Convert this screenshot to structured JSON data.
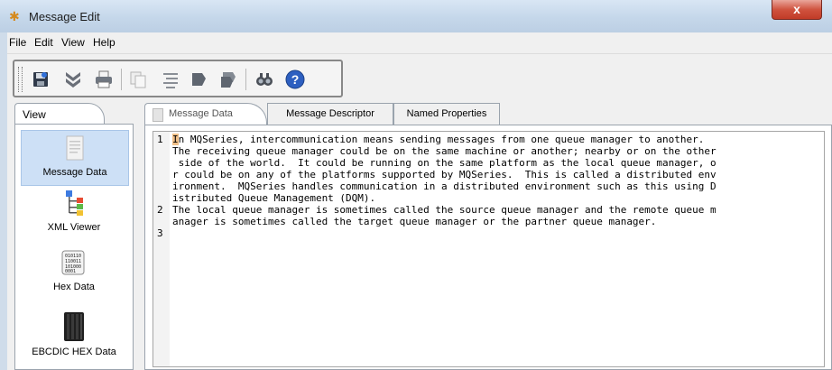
{
  "window": {
    "title": "Message Edit",
    "close_label": "x"
  },
  "menu": {
    "items": [
      "File",
      "Edit",
      "View",
      "Help"
    ]
  },
  "toolbar": {
    "buttons": [
      "save-icon",
      "download-icon",
      "print-icon",
      "copy-icon",
      "format-icon",
      "bookmark-icon",
      "bookmarks-icon",
      "find-icon",
      "help-icon"
    ]
  },
  "view_panel": {
    "tab_label": "View",
    "items": [
      {
        "label": "Message Data",
        "icon": "document-icon",
        "selected": true
      },
      {
        "label": "XML Viewer",
        "icon": "xml-tree-icon",
        "selected": false
      },
      {
        "label": "Hex Data",
        "icon": "hex-icon",
        "selected": false
      },
      {
        "label": "EBCDIC HEX Data",
        "icon": "server-icon",
        "selected": false
      }
    ]
  },
  "tabs": [
    {
      "label": "Message Data",
      "active": true
    },
    {
      "label": "Message Descriptor",
      "active": false
    },
    {
      "label": "Named Properties",
      "active": false
    }
  ],
  "editor": {
    "line_numbers": [
      "1",
      "2",
      "3"
    ],
    "lines": [
      "In MQSeries, intercommunication means sending messages from one queue manager to another.",
      "The receiving queue manager could be on the same machine or another; nearby or on the other",
      " side of the world.  It could be running on the same platform as the local queue manager, o",
      "r could be on any of the platforms supported by MQSeries.  This is called a distributed env",
      "ironment.  MQSeries handles communication in a distributed environment such as this using D",
      "istributed Queue Management (DQM).",
      "The local queue manager is sometimes called the source queue manager and the remote queue m",
      "anager is sometimes called the target queue manager or the partner queue manager."
    ]
  }
}
